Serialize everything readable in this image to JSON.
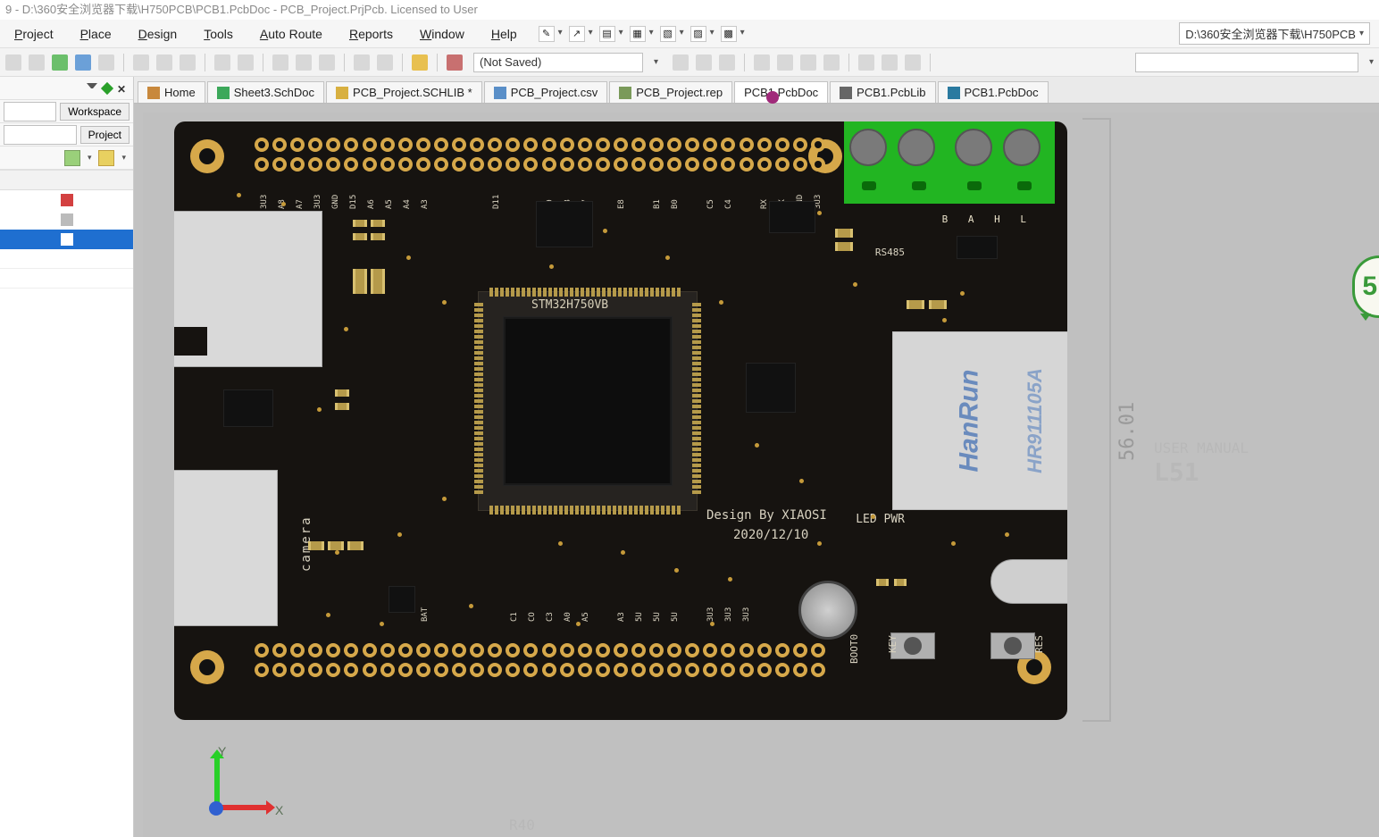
{
  "title_bar": "9 - D:\\360安全浏览器下载\\H750PCB\\PCB1.PcbDoc - PCB_Project.PrjPcb. Licensed to User",
  "menus": {
    "project": "Project",
    "place": "Place",
    "design": "Design",
    "tools": "Tools",
    "autoroute": "Auto Route",
    "reports": "Reports",
    "window": "Window",
    "help": "Help"
  },
  "path_box": "D:\\360安全浏览器下载\\H750PCB",
  "toolbar": {
    "saved_state": "(Not Saved)"
  },
  "side": {
    "workspace": "Workspace",
    "project": "Project"
  },
  "tabs": [
    {
      "label": "Home",
      "icon": "home"
    },
    {
      "label": "Sheet3.SchDoc",
      "icon": "sch"
    },
    {
      "label": "PCB_Project.SCHLIB *",
      "icon": "lib"
    },
    {
      "label": "PCB_Project.csv",
      "icon": "csv"
    },
    {
      "label": "PCB_Project.rep",
      "icon": "rep"
    },
    {
      "label": "PCB1.PcbDoc",
      "icon": "pcb",
      "active": true
    },
    {
      "label": "PCB1.PcbLib",
      "icon": "pcbl"
    },
    {
      "label": "PCB1.PcbDoc",
      "icon": "pcbd"
    }
  ],
  "pcb": {
    "mcu_label": "STM32H750VB",
    "design_by": "Design By XIAOSI",
    "date": "2020/12/10",
    "camera": "camera",
    "rs485": "RS485",
    "ledpwr": "LED PWR",
    "boot0": "BOOT0",
    "key": "KEY",
    "res": "RES",
    "eth_brand": "HanRun",
    "eth_model": "HR911105A",
    "term_labels": "B    A      H     L",
    "top_row_labels": [
      "3U3",
      "A8",
      "A7",
      "3U3",
      "GND",
      "D15",
      "A6",
      "A5",
      "A4",
      "A3",
      "",
      "",
      "",
      "D11",
      "",
      "",
      "D9",
      "D8",
      "E7",
      "",
      "E8",
      "",
      "B1",
      "B0",
      "",
      "C5",
      "C4",
      "",
      "RX",
      "TX",
      "GND",
      "3U3"
    ],
    "bot_row_labels": [
      "",
      "",
      "",
      "",
      "",
      "",
      "",
      "",
      "",
      "BAT",
      "",
      "",
      "",
      "",
      "C1",
      "CO",
      "C3",
      "A0",
      "A5",
      "",
      "A3",
      "5U",
      "5U",
      "5U",
      "",
      "3U3",
      "3U3",
      "3U3",
      "",
      "",
      ""
    ],
    "dimension_h": "56.01",
    "side_note_top": "USER MANUAL",
    "side_note_bot": "L51"
  },
  "viewport": {
    "ind_value": "5",
    "axis_x": "X",
    "axis_y": "Y",
    "r40": "R40"
  }
}
